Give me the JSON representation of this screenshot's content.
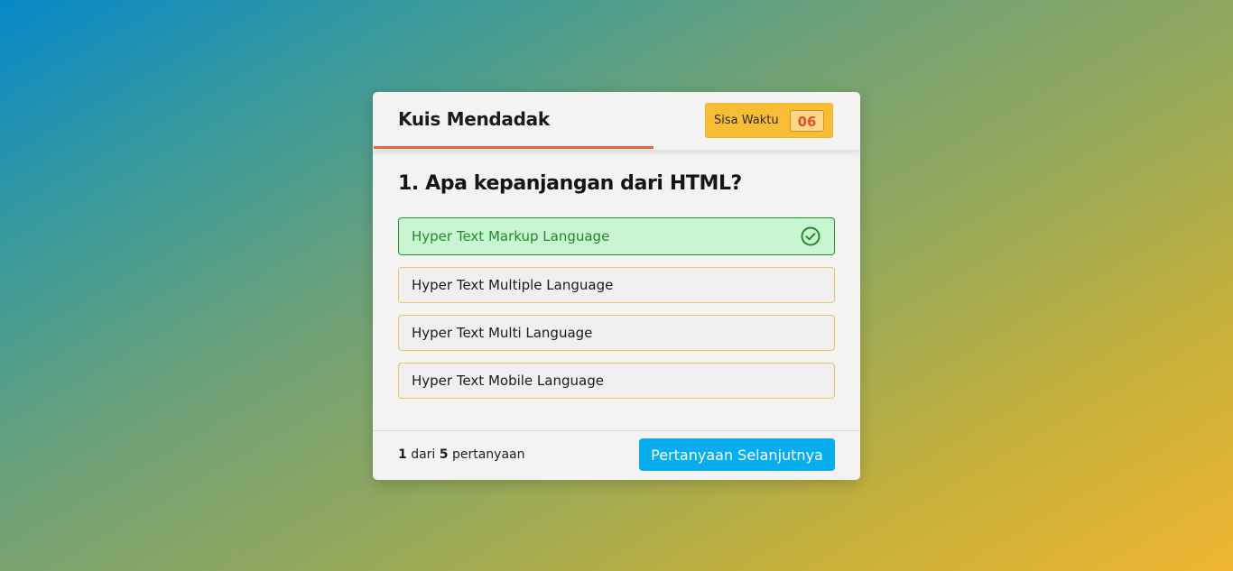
{
  "header": {
    "title": "Kuis Mendadak",
    "timer_label": "Sisa Waktu",
    "timer_value": "06"
  },
  "question": {
    "text": "1. Apa kepanjangan dari HTML?",
    "options": [
      {
        "label": "Hyper Text Markup Language",
        "state": "correct"
      },
      {
        "label": "Hyper Text Multiple Language",
        "state": "default"
      },
      {
        "label": "Hyper Text Multi Language",
        "state": "default"
      },
      {
        "label": "Hyper Text Mobile Language",
        "state": "default"
      }
    ]
  },
  "footer": {
    "current": "1",
    "between": "dari",
    "total": "5",
    "suffix": "pertanyaan",
    "next_label": "Pertanyaan Selanjutnya"
  },
  "colors": {
    "correct_bg": "#c9f6d2",
    "correct_text": "#238a29",
    "timer_bg": "#f8bd35",
    "progress": "#e5643b",
    "next_button": "#08adee"
  },
  "icons": {
    "correct_option": "check-circle-icon"
  }
}
